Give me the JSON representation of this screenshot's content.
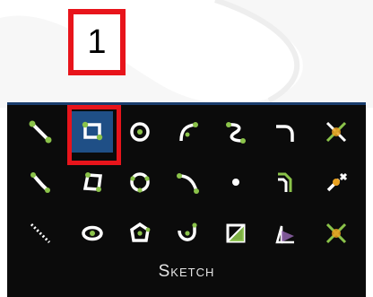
{
  "step": {
    "number": "1"
  },
  "panel": {
    "label": "Sketch"
  },
  "tools": [
    {
      "icon": "line-icon"
    },
    {
      "icon": "rectangle-icon",
      "active": true
    },
    {
      "icon": "circle-icon"
    },
    {
      "icon": "arc-icon"
    },
    {
      "icon": "spline-icon"
    },
    {
      "icon": "fillet-icon"
    },
    {
      "icon": "trim-icon"
    },
    {
      "icon": "two-point-line-icon"
    },
    {
      "icon": "polygon-rectangle-icon"
    },
    {
      "icon": "three-point-circle-icon"
    },
    {
      "icon": "three-point-arc-icon"
    },
    {
      "icon": "point-icon"
    },
    {
      "icon": "offset-icon"
    },
    {
      "icon": "extend-icon"
    },
    {
      "icon": "construction-line-icon"
    },
    {
      "icon": "ellipse-icon"
    },
    {
      "icon": "polygon-icon"
    },
    {
      "icon": "tangent-arc-icon"
    },
    {
      "icon": "mirror-icon"
    },
    {
      "icon": "project-icon"
    },
    {
      "icon": "split-icon"
    }
  ],
  "colors": {
    "accent_red": "#e8141b",
    "panel_bg": "#0b0b0b",
    "active_bg": "#1f4f86",
    "icon_white": "#ffffff",
    "icon_green": "#8bc34a",
    "icon_orange": "#e8a020"
  }
}
